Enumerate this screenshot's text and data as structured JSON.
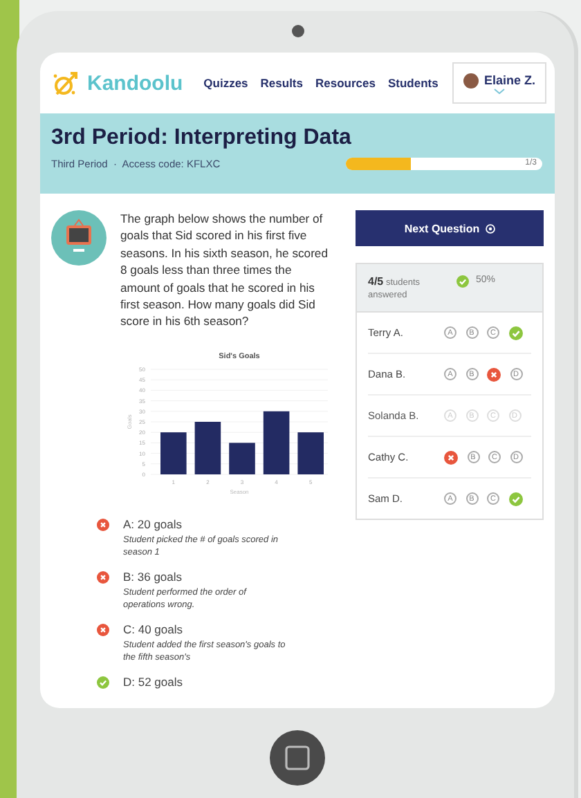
{
  "nav": {
    "brand": "Kandoolu",
    "links": [
      "Quizzes",
      "Results",
      "Resources",
      "Students"
    ],
    "user": "Elaine Z."
  },
  "banner": {
    "title": "3rd Period: Interpreting Data",
    "subtitle": "Third Period  ·  Access code: KFLXC",
    "progress": {
      "level": 0.33,
      "reading": "1/3"
    }
  },
  "question": {
    "text": "The graph below shows the number of goals that Sid scored in his first five seasons. In his sixth season, he scored 8 goals less than three times the amount of goals that he scored in his first season. How many goals did Sid score in his 6th season?",
    "chart_data": {
      "type": "bar",
      "title": "Sid's Goals",
      "xlabel": "Season",
      "ylabel": "Goals",
      "categories": [
        "1",
        "2",
        "3",
        "4",
        "5"
      ],
      "values": [
        20,
        25,
        15,
        30,
        20
      ],
      "ylim": [
        0,
        50
      ],
      "grid": true,
      "yticks": [
        0,
        5,
        10,
        15,
        20,
        25,
        30,
        35,
        40,
        45,
        50
      ]
    },
    "answers": [
      {
        "label": "A: 20 goals",
        "note": "Student picked the # of goals scored in season 1",
        "correct": false
      },
      {
        "label": "B: 36 goals",
        "note": "Student performed the order of operations wrong.",
        "correct": false
      },
      {
        "label": "C: 40 goals",
        "note": "Student added the first season's goals to the fifth season's",
        "correct": false
      },
      {
        "label": "D: 52 goals",
        "correct": true
      }
    ]
  },
  "next_button": "Next Question",
  "summary": {
    "count": "4/5",
    "count_label": "students answered",
    "score": "50%"
  },
  "students": [
    {
      "name": "Terry A.",
      "answered": true,
      "options": [
        {
          "kind": "letter",
          "letter": "A"
        },
        {
          "kind": "letter",
          "letter": "B"
        },
        {
          "kind": "letter",
          "letter": "C"
        },
        {
          "kind": "correct"
        }
      ]
    },
    {
      "name": "Dana B.",
      "answered": true,
      "options": [
        {
          "kind": "letter",
          "letter": "A"
        },
        {
          "kind": "letter",
          "letter": "B"
        },
        {
          "kind": "wrong"
        },
        {
          "kind": "letter",
          "letter": "D"
        }
      ]
    },
    {
      "name": "Solanda B.",
      "answered": false,
      "options": [
        {
          "kind": "letter",
          "letter": "A"
        },
        {
          "kind": "letter",
          "letter": "B"
        },
        {
          "kind": "letter",
          "letter": "C"
        },
        {
          "kind": "letter",
          "letter": "D"
        }
      ]
    },
    {
      "name": "Cathy C.",
      "answered": true,
      "options": [
        {
          "kind": "wrong"
        },
        {
          "kind": "letter",
          "letter": "B"
        },
        {
          "kind": "letter",
          "letter": "C"
        },
        {
          "kind": "letter",
          "letter": "D"
        }
      ]
    },
    {
      "name": "Sam D.",
      "answered": true,
      "options": [
        {
          "kind": "letter",
          "letter": "A"
        },
        {
          "kind": "letter",
          "letter": "B"
        },
        {
          "kind": "letter",
          "letter": "C"
        },
        {
          "kind": "correct"
        }
      ]
    }
  ]
}
